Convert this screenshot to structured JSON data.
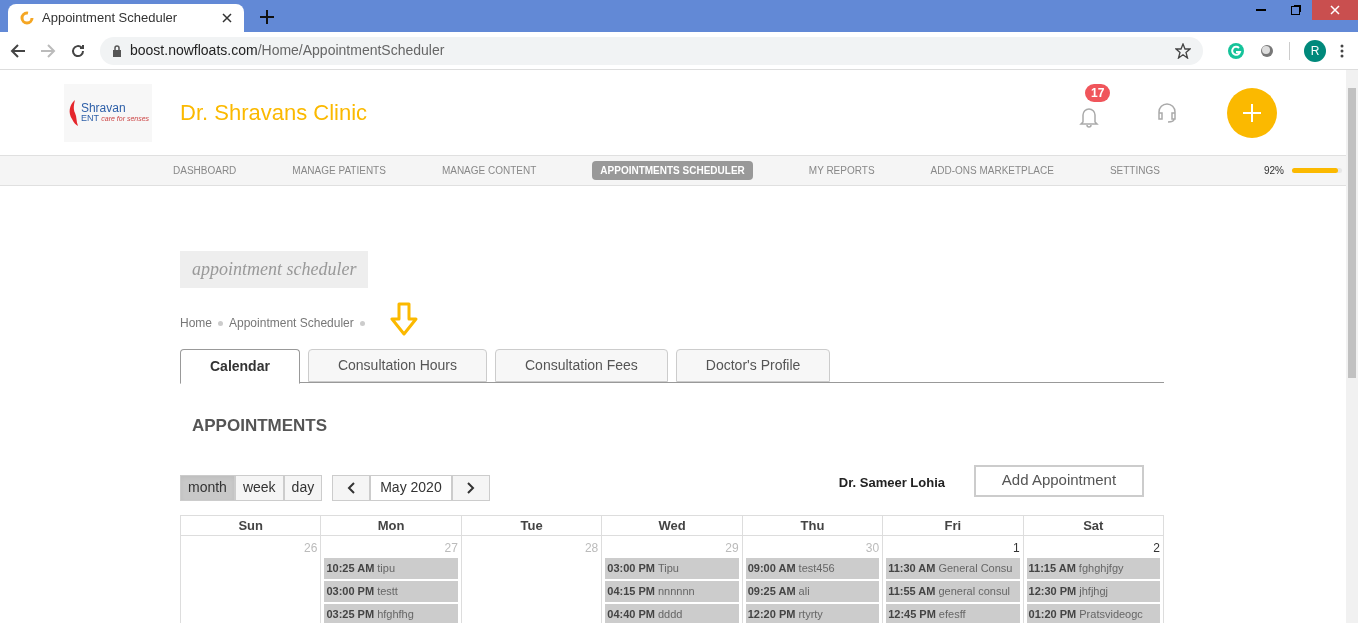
{
  "browser": {
    "tab_title": "Appointment Scheduler",
    "url_host": "boost.nowfloats.com",
    "url_path": "/Home/AppointmentScheduler",
    "profile_initial": "R"
  },
  "header": {
    "logo": {
      "name": "Shravan",
      "sub": "ENT",
      "tagline": "care for senses"
    },
    "clinic_name": "Dr. Shravans Clinic",
    "notification_count": "17"
  },
  "nav": {
    "items": [
      {
        "label": "DASHBOARD",
        "selected": false
      },
      {
        "label": "MANAGE PATIENTS",
        "selected": false
      },
      {
        "label": "MANAGE CONTENT",
        "selected": false
      },
      {
        "label": "APPOINTMENTS SCHEDULER",
        "selected": true
      },
      {
        "label": "MY REPORTS",
        "selected": false
      },
      {
        "label": "ADD-ONS MARKETPLACE",
        "selected": false
      },
      {
        "label": "SETTINGS",
        "selected": false
      }
    ],
    "profile_progress": {
      "reading": "92%",
      "level": 0.92
    }
  },
  "page_badge": "appointment scheduler",
  "breadcrumb": [
    "Home",
    "Appointment Scheduler"
  ],
  "tabs": [
    {
      "label": "Calendar",
      "selected": true
    },
    {
      "label": "Consultation Hours",
      "selected": false
    },
    {
      "label": "Consultation Fees",
      "selected": false
    },
    {
      "label": "Doctor's Profile",
      "selected": false
    }
  ],
  "section_title": "APPOINTMENTS",
  "views": [
    {
      "label": "month",
      "selected": true
    },
    {
      "label": "week",
      "selected": false
    },
    {
      "label": "day",
      "selected": false
    }
  ],
  "period": "May 2020",
  "doctor": "Dr. Sameer Lohia",
  "add_button": "Add Appointment",
  "calendar": {
    "weekdays": [
      "Sun",
      "Mon",
      "Tue",
      "Wed",
      "Thu",
      "Fri",
      "Sat"
    ],
    "days": [
      {
        "date": "26",
        "other_month": true
      },
      {
        "date": "27",
        "other_month": true,
        "events": [
          {
            "time": "10:25 AM",
            "title": "tipu"
          },
          {
            "time": "03:00 PM",
            "title": "testt"
          },
          {
            "time": "03:25 PM",
            "title": "hfghfhg"
          }
        ]
      },
      {
        "date": "28",
        "other_month": true
      },
      {
        "date": "29",
        "other_month": true,
        "events": [
          {
            "time": "03:00 PM",
            "title": "Tipu"
          },
          {
            "time": "04:15 PM",
            "title": "nnnnnn"
          },
          {
            "time": "04:40 PM",
            "title": "dddd"
          }
        ]
      },
      {
        "date": "30",
        "other_month": true,
        "events": [
          {
            "time": "09:00 AM",
            "title": "test456"
          },
          {
            "time": "09:25 AM",
            "title": "ali"
          },
          {
            "time": "12:20 PM",
            "title": "rtyrty"
          }
        ]
      },
      {
        "date": "1",
        "other_month": false,
        "events": [
          {
            "time": "11:30 AM",
            "title": "General Consu"
          },
          {
            "time": "11:55 AM",
            "title": "general consul"
          },
          {
            "time": "12:45 PM",
            "title": "efesff"
          }
        ]
      },
      {
        "date": "2",
        "other_month": false,
        "events": [
          {
            "time": "11:15 AM",
            "title": "fghghjfgy"
          },
          {
            "time": "12:30 PM",
            "title": "jhfjhgj"
          },
          {
            "time": "01:20 PM",
            "title": "Pratsvideogc"
          }
        ]
      }
    ]
  }
}
